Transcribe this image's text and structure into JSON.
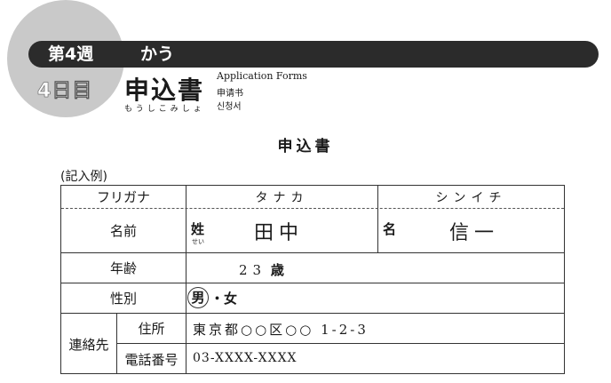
{
  "header": {
    "week_label": "第4週",
    "week_theme": "かう",
    "day_label": "4日目",
    "lesson_title": "申込書",
    "lesson_reading": "もうしこみしょ",
    "translations": {
      "english": "Application Forms",
      "chinese": "申请书",
      "korean": "신청서"
    }
  },
  "form": {
    "title": "申込書",
    "example_label": "(記入例)",
    "furigana": {
      "label": "フリガナ",
      "family": "タナカ",
      "given": "シンイチ"
    },
    "name": {
      "label": "名前",
      "family_label": "姓",
      "family_reading": "せい",
      "family_value": "田中",
      "given_label": "名",
      "given_value": "信一"
    },
    "age": {
      "label": "年齢",
      "value": "23",
      "unit": "歳"
    },
    "gender": {
      "label": "性別",
      "male": "男",
      "separator": "・",
      "female": "女"
    },
    "contact": {
      "label": "連絡先",
      "address_label": "住所",
      "address_value": "東京都○○区○○ 1-2-3",
      "phone_label": "電話番号",
      "phone_value": "03-XXXX-XXXX"
    }
  }
}
